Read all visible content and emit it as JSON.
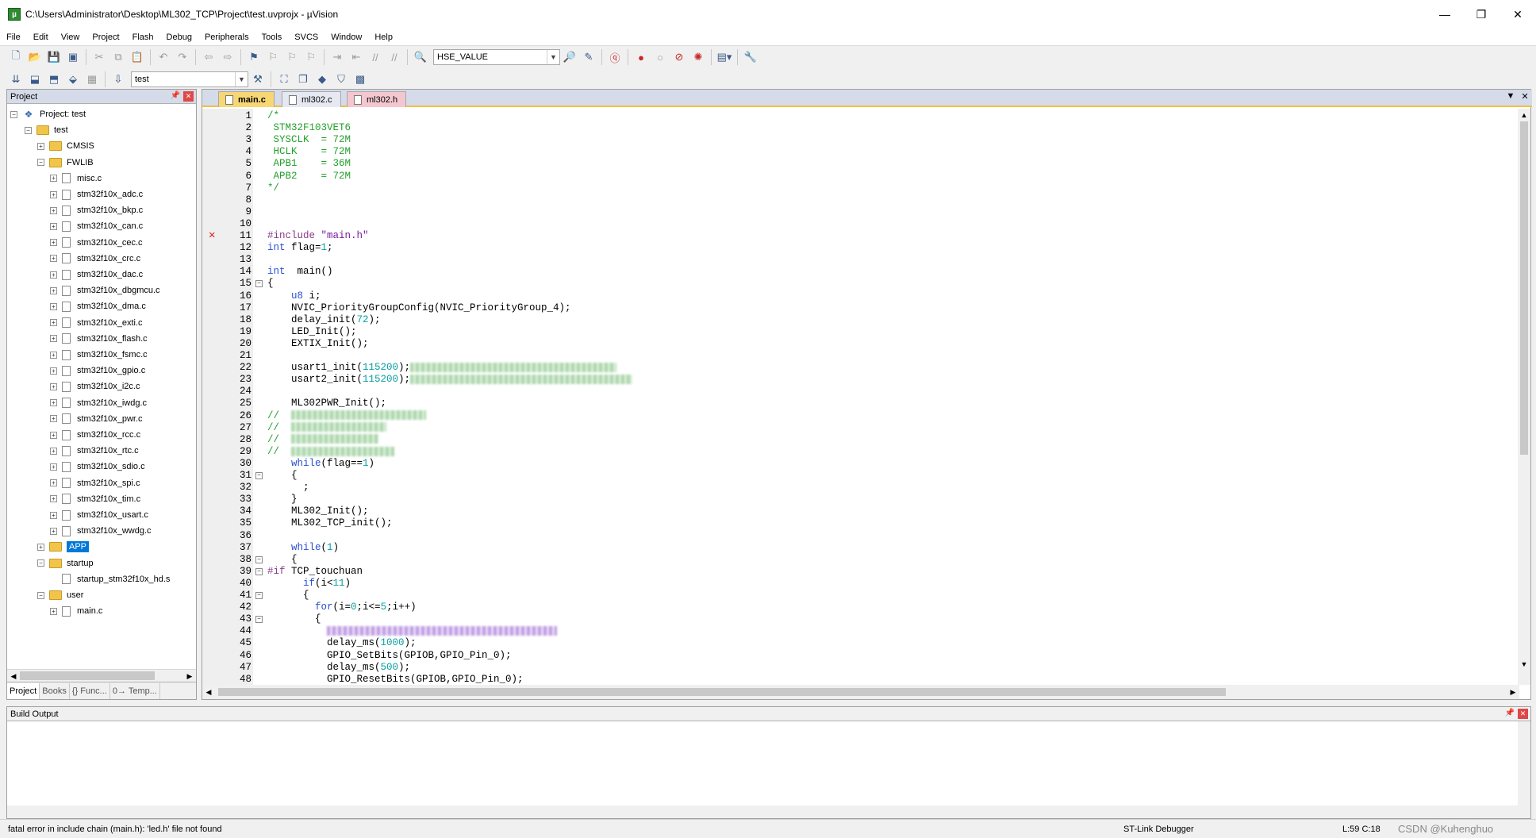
{
  "window": {
    "title": "C:\\Users\\Administrator\\Desktop\\ML302_TCP\\Project\\test.uvprojx - µVision",
    "minimize": "—",
    "maximize": "❐",
    "close": "✕"
  },
  "menu": [
    "File",
    "Edit",
    "View",
    "Project",
    "Flash",
    "Debug",
    "Peripherals",
    "Tools",
    "SVCS",
    "Window",
    "Help"
  ],
  "toolbar": {
    "find_combo": "HSE_VALUE",
    "target_combo": "test"
  },
  "project_panel": {
    "title": "Project",
    "tree": [
      {
        "label": "Project: test",
        "level": 0,
        "kind": "project",
        "exp": "−"
      },
      {
        "label": "test",
        "level": 1,
        "kind": "folder",
        "exp": "−"
      },
      {
        "label": "CMSIS",
        "level": 2,
        "kind": "folder",
        "exp": "+"
      },
      {
        "label": "FWLIB",
        "level": 2,
        "kind": "folder",
        "exp": "−"
      },
      {
        "label": "misc.c",
        "level": 3,
        "kind": "file",
        "exp": "+"
      },
      {
        "label": "stm32f10x_adc.c",
        "level": 3,
        "kind": "file",
        "exp": "+"
      },
      {
        "label": "stm32f10x_bkp.c",
        "level": 3,
        "kind": "file",
        "exp": "+"
      },
      {
        "label": "stm32f10x_can.c",
        "level": 3,
        "kind": "file",
        "exp": "+"
      },
      {
        "label": "stm32f10x_cec.c",
        "level": 3,
        "kind": "file",
        "exp": "+"
      },
      {
        "label": "stm32f10x_crc.c",
        "level": 3,
        "kind": "file",
        "exp": "+"
      },
      {
        "label": "stm32f10x_dac.c",
        "level": 3,
        "kind": "file",
        "exp": "+"
      },
      {
        "label": "stm32f10x_dbgmcu.c",
        "level": 3,
        "kind": "file",
        "exp": "+"
      },
      {
        "label": "stm32f10x_dma.c",
        "level": 3,
        "kind": "file",
        "exp": "+"
      },
      {
        "label": "stm32f10x_exti.c",
        "level": 3,
        "kind": "file",
        "exp": "+"
      },
      {
        "label": "stm32f10x_flash.c",
        "level": 3,
        "kind": "file",
        "exp": "+"
      },
      {
        "label": "stm32f10x_fsmc.c",
        "level": 3,
        "kind": "file",
        "exp": "+"
      },
      {
        "label": "stm32f10x_gpio.c",
        "level": 3,
        "kind": "file",
        "exp": "+"
      },
      {
        "label": "stm32f10x_i2c.c",
        "level": 3,
        "kind": "file",
        "exp": "+"
      },
      {
        "label": "stm32f10x_iwdg.c",
        "level": 3,
        "kind": "file",
        "exp": "+"
      },
      {
        "label": "stm32f10x_pwr.c",
        "level": 3,
        "kind": "file",
        "exp": "+"
      },
      {
        "label": "stm32f10x_rcc.c",
        "level": 3,
        "kind": "file",
        "exp": "+"
      },
      {
        "label": "stm32f10x_rtc.c",
        "level": 3,
        "kind": "file",
        "exp": "+"
      },
      {
        "label": "stm32f10x_sdio.c",
        "level": 3,
        "kind": "file",
        "exp": "+"
      },
      {
        "label": "stm32f10x_spi.c",
        "level": 3,
        "kind": "file",
        "exp": "+"
      },
      {
        "label": "stm32f10x_tim.c",
        "level": 3,
        "kind": "file",
        "exp": "+"
      },
      {
        "label": "stm32f10x_usart.c",
        "level": 3,
        "kind": "file",
        "exp": "+"
      },
      {
        "label": "stm32f10x_wwdg.c",
        "level": 3,
        "kind": "file",
        "exp": "+"
      },
      {
        "label": "APP",
        "level": 2,
        "kind": "folder",
        "exp": "+",
        "selected": true
      },
      {
        "label": "startup",
        "level": 2,
        "kind": "folder",
        "exp": "−"
      },
      {
        "label": "startup_stm32f10x_hd.s",
        "level": 3,
        "kind": "file",
        "exp": ""
      },
      {
        "label": "user",
        "level": 2,
        "kind": "folder",
        "exp": "−"
      },
      {
        "label": "main.c",
        "level": 3,
        "kind": "file",
        "exp": "+"
      }
    ],
    "tabs": [
      "Project",
      "Books",
      "{} Func...",
      "0→ Temp..."
    ]
  },
  "editor": {
    "tabs": [
      {
        "label": "main.c",
        "state": "active"
      },
      {
        "label": "ml302.c",
        "state": "inactive"
      },
      {
        "label": "ml302.h",
        "state": "pink"
      }
    ],
    "lines": [
      {
        "n": "1",
        "f": "",
        "c": [
          [
            "com",
            "/*"
          ]
        ]
      },
      {
        "n": "2",
        "f": "",
        "c": [
          [
            "com",
            " STM32F103VET6"
          ]
        ]
      },
      {
        "n": "3",
        "f": "",
        "c": [
          [
            "com",
            " SYSCLK  = 72M"
          ]
        ]
      },
      {
        "n": "4",
        "f": "",
        "c": [
          [
            "com",
            " HCLK    = 72M"
          ]
        ]
      },
      {
        "n": "5",
        "f": "",
        "c": [
          [
            "com",
            " APB1    = 36M"
          ]
        ]
      },
      {
        "n": "6",
        "f": "",
        "c": [
          [
            "com",
            " APB2    = 72M"
          ]
        ]
      },
      {
        "n": "7",
        "f": "",
        "c": [
          [
            "com",
            "*/"
          ]
        ]
      },
      {
        "n": "8",
        "f": "",
        "c": []
      },
      {
        "n": "9",
        "f": "",
        "c": []
      },
      {
        "n": "10",
        "f": "",
        "c": []
      },
      {
        "n": "11",
        "f": "",
        "err": true,
        "c": [
          [
            "pp",
            "#include "
          ],
          [
            "str",
            "\"main.h\""
          ]
        ]
      },
      {
        "n": "12",
        "f": "",
        "c": [
          [
            "kw",
            "int"
          ],
          [
            "t",
            " flag="
          ],
          [
            "num",
            "1"
          ],
          [
            "t",
            ";"
          ]
        ]
      },
      {
        "n": "13",
        "f": "",
        "c": []
      },
      {
        "n": "14",
        "f": "",
        "c": [
          [
            "kw",
            "int"
          ],
          [
            "t",
            "  main()"
          ]
        ]
      },
      {
        "n": "15",
        "f": "−",
        "c": [
          [
            "t",
            "{"
          ]
        ]
      },
      {
        "n": "16",
        "f": "",
        "c": [
          [
            "kw",
            "    u8"
          ],
          [
            "t",
            " i;"
          ]
        ]
      },
      {
        "n": "17",
        "f": "",
        "c": [
          [
            "t",
            "    NVIC_PriorityGroupConfig(NVIC_PriorityGroup_4);"
          ]
        ]
      },
      {
        "n": "18",
        "f": "",
        "c": [
          [
            "t",
            "    delay_init("
          ],
          [
            "num",
            "72"
          ],
          [
            "t",
            ");"
          ]
        ]
      },
      {
        "n": "19",
        "f": "",
        "c": [
          [
            "t",
            "    LED_Init();"
          ]
        ]
      },
      {
        "n": "20",
        "f": "",
        "c": [
          [
            "t",
            "    EXTIX_Init();"
          ]
        ]
      },
      {
        "n": "21",
        "f": "",
        "c": []
      },
      {
        "n": "22",
        "f": "",
        "c": [
          [
            "t",
            "    usart1_init("
          ],
          [
            "num",
            "115200"
          ],
          [
            "t",
            ");"
          ],
          [
            "blur",
            "260"
          ]
        ]
      },
      {
        "n": "23",
        "f": "",
        "c": [
          [
            "t",
            "    usart2_init("
          ],
          [
            "num",
            "115200"
          ],
          [
            "t",
            ");"
          ],
          [
            "blur",
            "280"
          ]
        ]
      },
      {
        "n": "24",
        "f": "",
        "c": []
      },
      {
        "n": "25",
        "f": "",
        "c": [
          [
            "t",
            "    ML302PWR_Init();"
          ]
        ]
      },
      {
        "n": "26",
        "f": "",
        "c": [
          [
            "com",
            "//  "
          ],
          [
            "blur",
            "170"
          ]
        ]
      },
      {
        "n": "27",
        "f": "",
        "c": [
          [
            "com",
            "//  "
          ],
          [
            "blur",
            "120"
          ]
        ]
      },
      {
        "n": "28",
        "f": "",
        "c": [
          [
            "com",
            "//  "
          ],
          [
            "blur",
            "110"
          ]
        ]
      },
      {
        "n": "29",
        "f": "",
        "c": [
          [
            "com",
            "//  "
          ],
          [
            "blur",
            "130"
          ]
        ]
      },
      {
        "n": "30",
        "f": "",
        "c": [
          [
            "kw",
            "    while"
          ],
          [
            "t",
            "(flag=="
          ],
          [
            "num",
            "1"
          ],
          [
            "t",
            ")"
          ]
        ]
      },
      {
        "n": "31",
        "f": "−",
        "c": [
          [
            "t",
            "    {"
          ]
        ]
      },
      {
        "n": "32",
        "f": "",
        "c": [
          [
            "t",
            "      ;"
          ]
        ]
      },
      {
        "n": "33",
        "f": "",
        "c": [
          [
            "t",
            "    }"
          ]
        ]
      },
      {
        "n": "34",
        "f": "",
        "c": [
          [
            "t",
            "    ML302_Init();"
          ]
        ]
      },
      {
        "n": "35",
        "f": "",
        "c": [
          [
            "t",
            "    ML302_TCP_init();"
          ]
        ]
      },
      {
        "n": "36",
        "f": "",
        "c": []
      },
      {
        "n": "37",
        "f": "",
        "c": [
          [
            "kw",
            "    while"
          ],
          [
            "t",
            "("
          ],
          [
            "num",
            "1"
          ],
          [
            "t",
            ")"
          ]
        ]
      },
      {
        "n": "38",
        "f": "−",
        "c": [
          [
            "t",
            "    {"
          ]
        ]
      },
      {
        "n": "39",
        "f": "−",
        "c": [
          [
            "pp",
            "#if"
          ],
          [
            "t",
            " TCP_touchuan"
          ]
        ]
      },
      {
        "n": "40",
        "f": "",
        "c": [
          [
            "kw",
            "      if"
          ],
          [
            "t",
            "(i<"
          ],
          [
            "num",
            "11"
          ],
          [
            "t",
            ")"
          ]
        ]
      },
      {
        "n": "41",
        "f": "−",
        "c": [
          [
            "t",
            "      {"
          ]
        ]
      },
      {
        "n": "42",
        "f": "",
        "c": [
          [
            "kw",
            "        for"
          ],
          [
            "t",
            "(i="
          ],
          [
            "num",
            "0"
          ],
          [
            "t",
            ";i<="
          ],
          [
            "num",
            "5"
          ],
          [
            "t",
            ";i++)"
          ]
        ]
      },
      {
        "n": "43",
        "f": "−",
        "c": [
          [
            "t",
            "        {"
          ]
        ]
      },
      {
        "n": "44",
        "f": "",
        "c": [
          [
            "t",
            "          "
          ],
          [
            "blurp",
            "290"
          ]
        ]
      },
      {
        "n": "45",
        "f": "",
        "c": [
          [
            "t",
            "          delay_ms("
          ],
          [
            "num",
            "1000"
          ],
          [
            "t",
            ");"
          ]
        ]
      },
      {
        "n": "46",
        "f": "",
        "c": [
          [
            "t",
            "          GPIO_SetBits(GPIOB,GPIO_Pin_0);"
          ]
        ]
      },
      {
        "n": "47",
        "f": "",
        "c": [
          [
            "t",
            "          delay_ms("
          ],
          [
            "num",
            "500"
          ],
          [
            "t",
            ");"
          ]
        ]
      },
      {
        "n": "48",
        "f": "",
        "c": [
          [
            "t",
            "          GPIO_ResetBits(GPIOB,GPIO_Pin_0);"
          ]
        ]
      }
    ]
  },
  "build_output": {
    "title": "Build Output"
  },
  "status": {
    "message": "fatal error in include chain (main.h): 'led.h' file not found",
    "debugger": "ST-Link Debugger",
    "position": "L:59 C:18",
    "watermark": "CSDN @Kuhenghuo"
  }
}
